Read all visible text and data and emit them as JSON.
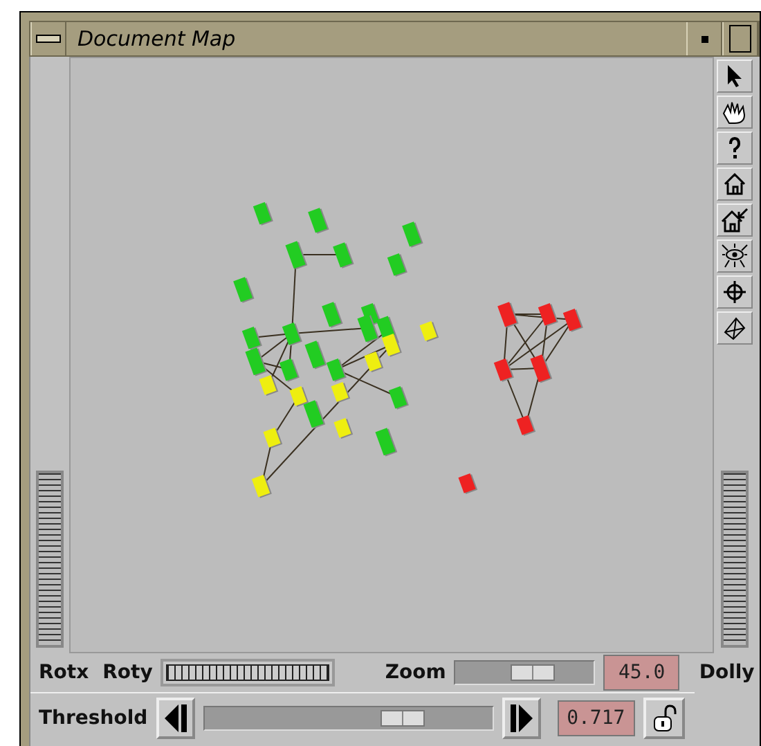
{
  "window": {
    "title": "Document Map"
  },
  "controls": {
    "rotx_label": "Rotx",
    "roty_label": "Roty",
    "zoom_label": "Zoom",
    "zoom": {
      "level": 0.56
    },
    "zoom_value": "45.0",
    "dolly_label": "Dolly"
  },
  "threshold": {
    "label": "Threshold",
    "slider": {
      "level": 0.69
    },
    "value": "0.717",
    "locked": false
  }
}
